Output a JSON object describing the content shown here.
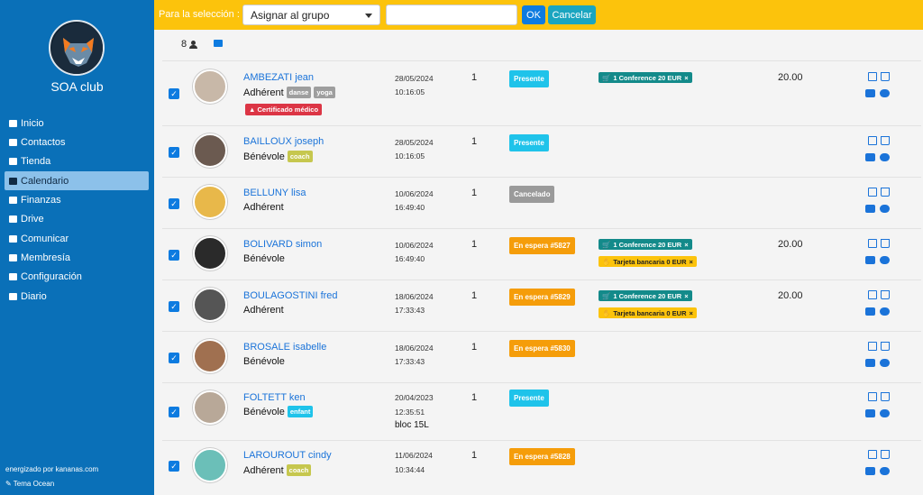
{
  "sidebar": {
    "club_name": "SOA club",
    "items": [
      {
        "label": "Inicio",
        "icon": "home-icon"
      },
      {
        "label": "Contactos",
        "icon": "users-icon"
      },
      {
        "label": "Tienda",
        "icon": "store-icon"
      },
      {
        "label": "Calendario",
        "icon": "calendar-icon"
      },
      {
        "label": "Finanzas",
        "icon": "piggy-bank-icon"
      },
      {
        "label": "Drive",
        "icon": "hard-drive-icon"
      },
      {
        "label": "Comunicar",
        "icon": "broadcast-icon"
      },
      {
        "label": "Membresía",
        "icon": "member-icon"
      },
      {
        "label": "Configuración",
        "icon": "gear-icon"
      },
      {
        "label": "Diario",
        "icon": "book-icon"
      }
    ],
    "active_item": "Calendario",
    "powered_by": "energizado por kananas.com",
    "theme": "Tema Ocean"
  },
  "toolbar": {
    "selection_label": "Para la selección :",
    "select_value": "Asignar al grupo",
    "input_value": "",
    "ok_label": "OK",
    "cancel_label": "Cancelar"
  },
  "summary": {
    "count": "8"
  },
  "rows": [
    {
      "name": "AMBEZATI jean",
      "role": "Adhérent",
      "tags": [
        "danse",
        "yoga"
      ],
      "warning": "Certificado médico",
      "date": "28/05/2024",
      "time": "10:16:05",
      "qty": "1",
      "status": "Presente",
      "payments": [
        "1 Conference 20 EUR"
      ],
      "amount": "20.00"
    },
    {
      "name": "BAILLOUX joseph",
      "role": "Bénévole",
      "tags": [
        "coach"
      ],
      "date": "28/05/2024",
      "time": "10:16:05",
      "qty": "1",
      "status": "Presente",
      "payments": [],
      "amount": ""
    },
    {
      "name": "BELLUNY lisa",
      "role": "Adhérent",
      "tags": [],
      "date": "10/06/2024",
      "time": "16:49:40",
      "qty": "1",
      "status": "Cancelado",
      "payments": [],
      "amount": ""
    },
    {
      "name": "BOLIVARD simon",
      "role": "Bénévole",
      "tags": [],
      "date": "10/06/2024",
      "time": "16:49:40",
      "qty": "1",
      "status": "En espera #5827",
      "payments": [
        "1 Conference 20 EUR",
        "Tarjeta bancaria 0 EUR"
      ],
      "amount": "20.00"
    },
    {
      "name": "BOULAGOSTINI fred",
      "role": "Adhérent",
      "tags": [],
      "date": "18/06/2024",
      "time": "17:33:43",
      "qty": "1",
      "status": "En espera #5829",
      "payments": [
        "1 Conference 20 EUR",
        "Tarjeta bancaria 0 EUR"
      ],
      "amount": "20.00"
    },
    {
      "name": "BROSALE isabelle",
      "role": "Bénévole",
      "tags": [],
      "date": "18/06/2024",
      "time": "17:33:43",
      "qty": "1",
      "status": "En espera #5830",
      "payments": [],
      "amount": ""
    },
    {
      "name": "FOLTETT ken",
      "role": "Bénévole",
      "tags": [
        "enfant"
      ],
      "date": "20/04/2023",
      "time": "12:35:51",
      "note": "bloc 15L",
      "qty": "1",
      "status": "Presente",
      "payments": [],
      "amount": ""
    },
    {
      "name": "LAROUROUT cindy",
      "role": "Adhérent",
      "tags": [
        "coach"
      ],
      "date": "11/06/2024",
      "time": "10:34:44",
      "qty": "1",
      "status": "En espera #5828",
      "payments": [],
      "amount": ""
    }
  ],
  "colors": {
    "sidebar": "#0a70b8",
    "topbar": "#fcc30c",
    "link": "#1a73d9",
    "status_presente": "#1fc3ea",
    "status_cancelado": "#9a9a9a",
    "status_espera": "#f59d0a",
    "tag_grey": "#9e9e9e",
    "tag_coach": "#c6c74e",
    "tag_enfant": "#1fc3ea"
  }
}
